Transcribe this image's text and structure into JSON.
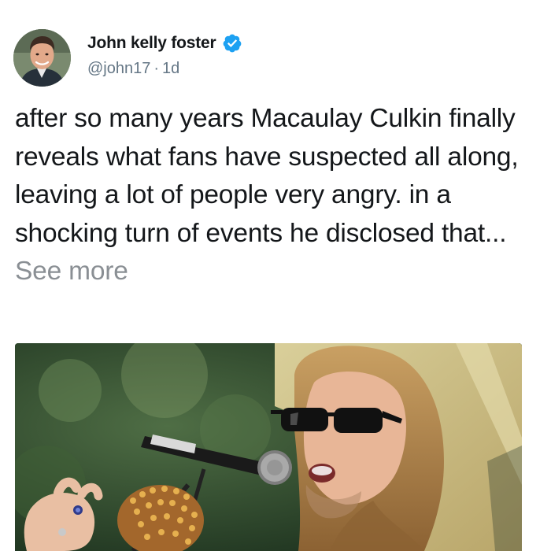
{
  "author": {
    "display_name": "John kelly foster",
    "handle": "@john17",
    "separator": "·",
    "time": "1d",
    "verified": true,
    "avatar_icon": "profile-photo",
    "verified_icon": "verified-badge-icon",
    "verified_color": "#1da1f2"
  },
  "tweet": {
    "text": "after so many years Macaulay Culkin finally reveals what fans have suspected all along, leaving a lot of people very angry. in a shocking turn of events he disclosed that...",
    "see_more": "See more"
  },
  "media": {
    "icon": "photo-singer-with-microphone"
  },
  "colors": {
    "text": "#14171a",
    "secondary": "#657786",
    "see_more": "#8a8f94"
  }
}
